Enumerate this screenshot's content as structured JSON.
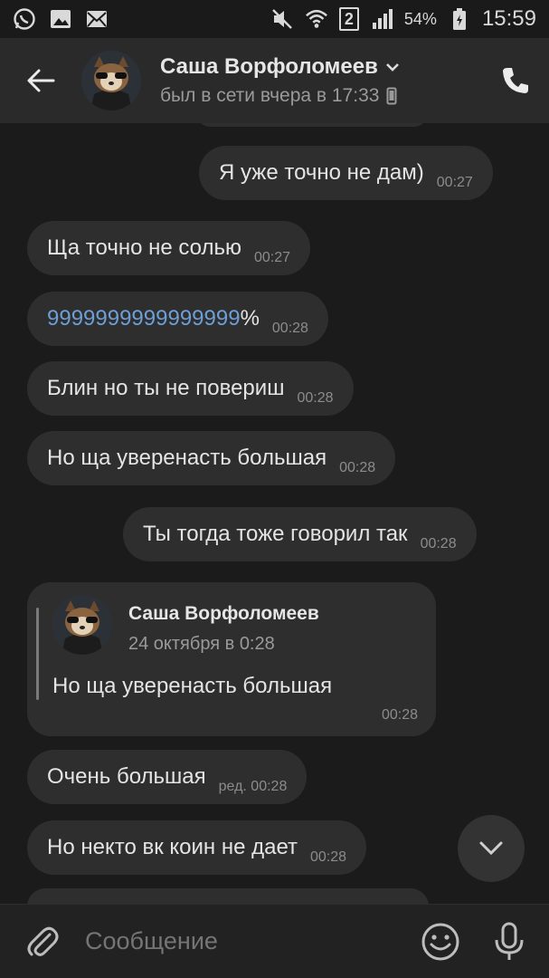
{
  "status_bar": {
    "icons_left": [
      "whatsapp-icon",
      "image-icon",
      "mail-icon"
    ],
    "sim": "2",
    "battery_percent": "54%",
    "time": "15:59"
  },
  "header": {
    "name": "Саша Ворфоломеев",
    "status": "был в сети вчера в 17:33"
  },
  "messages": [
    {
      "side": "out",
      "text": "Я уже точно не дам)",
      "time": "00:27"
    },
    {
      "side": "in",
      "text": "Ща точно не солью",
      "time": "00:27"
    },
    {
      "side": "in",
      "link": "9999999999999999",
      "text": "%",
      "time": "00:28"
    },
    {
      "side": "in",
      "text": "Блин но ты не повериш",
      "time": "00:28"
    },
    {
      "side": "in",
      "text": "Но ща уверенасть большая",
      "time": "00:28"
    },
    {
      "side": "out",
      "text": "Ты тогда тоже говорил так",
      "time": "00:28"
    },
    {
      "side": "in",
      "text": "Очень большая",
      "time": "ред. 00:28"
    },
    {
      "side": "in",
      "text": "Но некто вк коин не дает",
      "time": "00:28"
    }
  ],
  "reply": {
    "name": "Саша Ворфоломеев",
    "date": "24 октября в 0:28",
    "text": "Но ща уверенасть большая",
    "time": "00:28"
  },
  "composer": {
    "placeholder": "Сообщение"
  },
  "colors": {
    "background": "#1b1b1b",
    "bubble": "#2e2e2e",
    "header": "#2a2a2a",
    "link": "#6d9fd6"
  }
}
